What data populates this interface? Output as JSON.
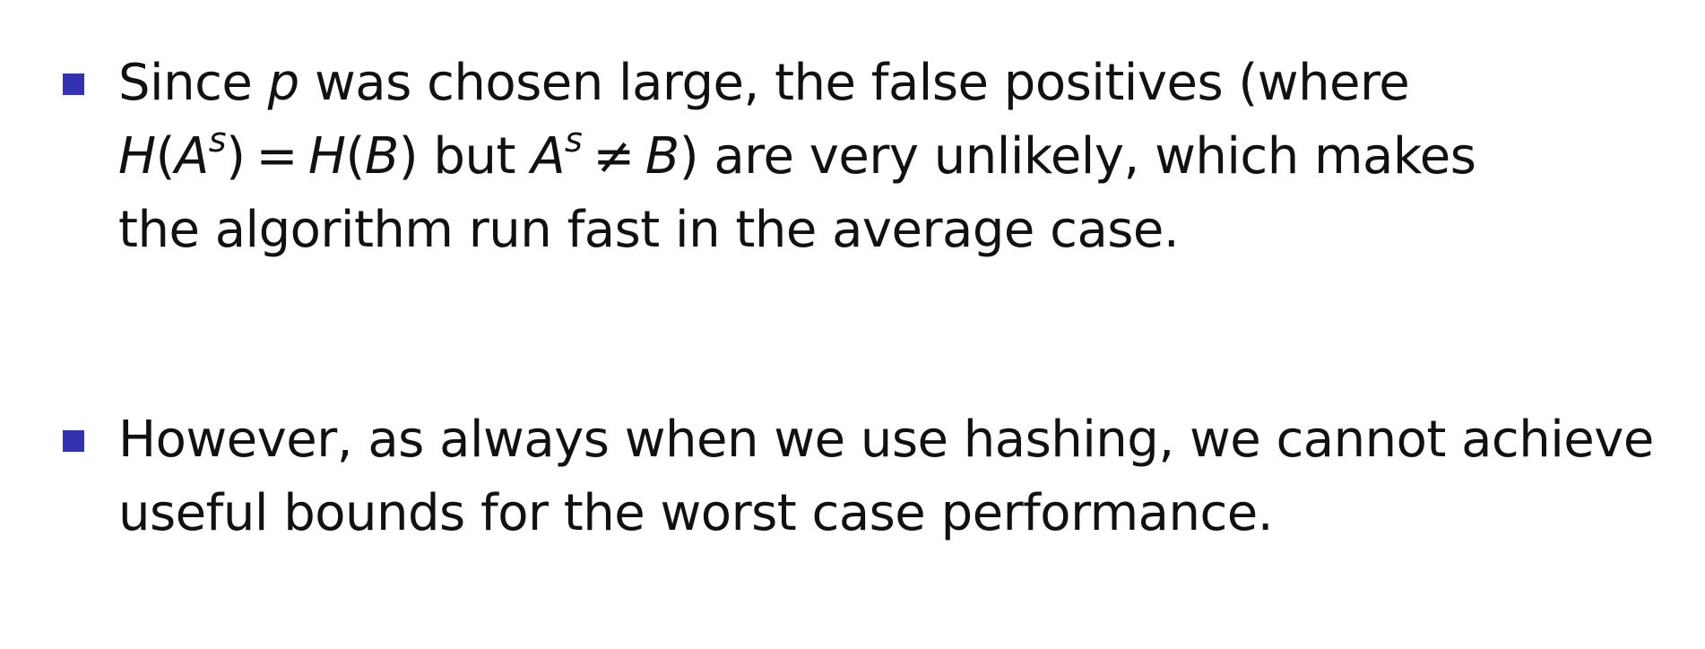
{
  "colors": {
    "bullet_marker": "#3333b2",
    "text": "#111111",
    "background": "#ffffff"
  },
  "bullets": [
    {
      "lines": [
        {
          "pre": "Since ",
          "var_p": "p",
          "post": " was chosen large, the false positives (where"
        },
        {
          "m1_H": "H",
          "m1_lp": "(",
          "m1_A": "A",
          "m1_s": "s",
          "m1_rp": ")",
          "m1_eq": "=",
          "m1_H2": "H",
          "m1_lp2": "(",
          "m1_B": "B",
          "m1_rp2": ")",
          "mid": " but ",
          "m2_A": "A",
          "m2_s": "s",
          "m2_ne": "≠",
          "m2_B": "B",
          "m2_rp": ")",
          "post": " are very unlikely, which makes"
        },
        {
          "text": "the algorithm run fast in the average case."
        }
      ]
    },
    {
      "lines": [
        {
          "text": "However, as always when we use hashing, we cannot achieve"
        },
        {
          "text": "useful bounds for the worst case performance."
        }
      ]
    }
  ]
}
